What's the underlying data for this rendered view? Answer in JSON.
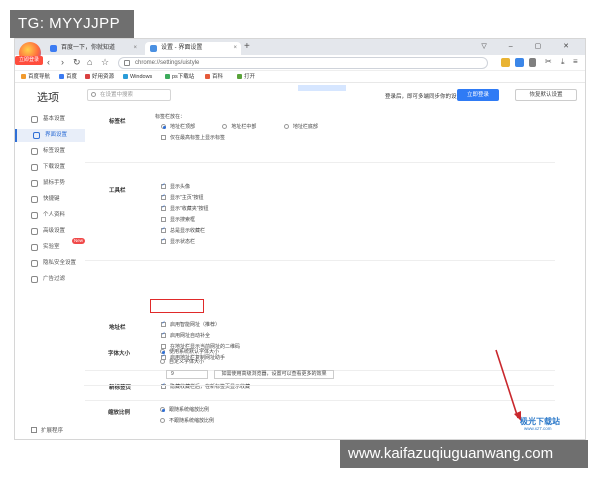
{
  "overlay": {
    "tg_tag": "TG: MYYJJPP",
    "watermark_url": "www.kaifazuqiuguanwang.com"
  },
  "browser": {
    "logo_badge": "立即登录",
    "tabs": [
      {
        "label": "百度一下，你就知道"
      },
      {
        "label": "设置 - 界面设置"
      }
    ],
    "new_tab": "+",
    "address": "chrome://settings/uistyle",
    "window_controls": "▽ – ▢ ✕",
    "bookmarks": [
      "百度导航",
      "百度",
      "好用资源",
      "Windows",
      "ps下载站",
      "百科",
      "打开"
    ]
  },
  "settings": {
    "title": "选项",
    "search_placeholder": "在设置中搜索",
    "login_tip": "登录后，即可多端同步你的设置",
    "login_button": "立即登录",
    "reset_button": "恢复默认设置",
    "sidebar": [
      {
        "label": "基本设置",
        "icon": "home-icon"
      },
      {
        "label": "界面设置",
        "icon": "layout-icon"
      },
      {
        "label": "标签设置",
        "icon": "tag-icon"
      },
      {
        "label": "下载设置",
        "icon": "download-icon"
      },
      {
        "label": "鼠标手势",
        "icon": "gesture-icon"
      },
      {
        "label": "快捷键",
        "icon": "keyboard-icon"
      },
      {
        "label": "个人资料",
        "icon": "user-icon"
      },
      {
        "label": "高级设置",
        "icon": "gear-icon"
      },
      {
        "label": "实验室",
        "icon": "lab-icon"
      },
      {
        "label": "隐私安全设置",
        "icon": "shield-icon"
      },
      {
        "label": "广告过滤",
        "icon": "filter-icon"
      }
    ],
    "new_badge": "New",
    "sidebar_footer": "扩展程序",
    "sections": {
      "tabbar": {
        "label": "标签栏",
        "position_label": "标签栏放在：",
        "radios": [
          "地址栏顶部",
          "地址栏中部",
          "地址栏底部"
        ],
        "checkbox": "仅在最高标签上显示标签"
      },
      "toolbar": {
        "label": "工具栏",
        "items": [
          "显示头像",
          "显示\"主页\"按钮",
          "显示\"收藏夹\"按钮",
          "显示搜索框",
          "总是显示收藏栏",
          "显示状态栏"
        ]
      },
      "addressbar": {
        "label": "地址栏",
        "items": [
          "启用智能网址（推荐）",
          "启用网址自动补全",
          "在地址栏显示当前网址的二维码",
          "启用地址栏复制网址助手"
        ]
      },
      "newtab": {
        "label": "新标签页",
        "item": "隐藏收藏栏后，在新标签页显示收藏"
      },
      "fontsize": {
        "label": "字体大小",
        "radios": [
          "使用系统默认字体大小",
          "自定义字体大小"
        ],
        "select_value": "9",
        "note": "如需使用高级浏览器，设置可以查看更多的效果"
      },
      "zoom": {
        "label": "缩放比例",
        "radios": [
          "跟随系统缩放比例",
          "不跟随系统缩放比例"
        ]
      }
    }
  },
  "brand": {
    "name": "极光下载站",
    "site": "www.xz7.com"
  }
}
